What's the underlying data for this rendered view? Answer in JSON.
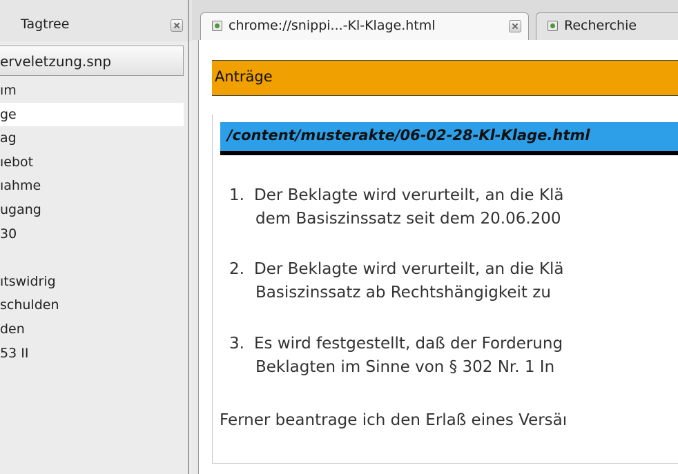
{
  "sidebar": {
    "title": "Tagtree",
    "file": "erveletzung.snp",
    "items": [
      {
        "label": "ım",
        "selected": false
      },
      {
        "label": "ge",
        "selected": true
      },
      {
        "label": "ag",
        "selected": false
      },
      {
        "label": "ıebot",
        "selected": false
      },
      {
        "label": "ıahme",
        "selected": false
      },
      {
        "label": "ugang",
        "selected": false
      },
      {
        "label": "30",
        "selected": false
      },
      {
        "label": "",
        "selected": false
      },
      {
        "label": "ıtswidrig",
        "selected": false
      },
      {
        "label": "schulden",
        "selected": false
      },
      {
        "label": "den",
        "selected": false
      },
      {
        "label": "53 II",
        "selected": false
      }
    ]
  },
  "tabs": [
    {
      "label": "chrome://snippi...-Kl-Klage.html",
      "active": true
    },
    {
      "label": "Recherchie",
      "active": false
    }
  ],
  "content": {
    "heading": "Anträge",
    "path": "/content/musterakte/06-02-28-Kl-Klage.html",
    "items": [
      {
        "num": "1.",
        "line1": "Der Beklagte wird verurteilt, an die Klä",
        "line2": "dem Basiszinssatz seit dem 20.06.200"
      },
      {
        "num": "2.",
        "line1": "Der Beklagte wird verurteilt, an die Klä",
        "line2": "Basiszinssatz ab Rechtshängigkeit zu"
      },
      {
        "num": "3.",
        "line1": "Es wird festgestellt, daß der Forderung",
        "line2": "Beklagten im Sinne von § 302 Nr. 1 In"
      }
    ],
    "final": "Ferner beantrage ich den Erlaß eines Versäı"
  },
  "colors": {
    "heading_bg": "#f0a000",
    "path_bg": "#2d9fe8"
  }
}
